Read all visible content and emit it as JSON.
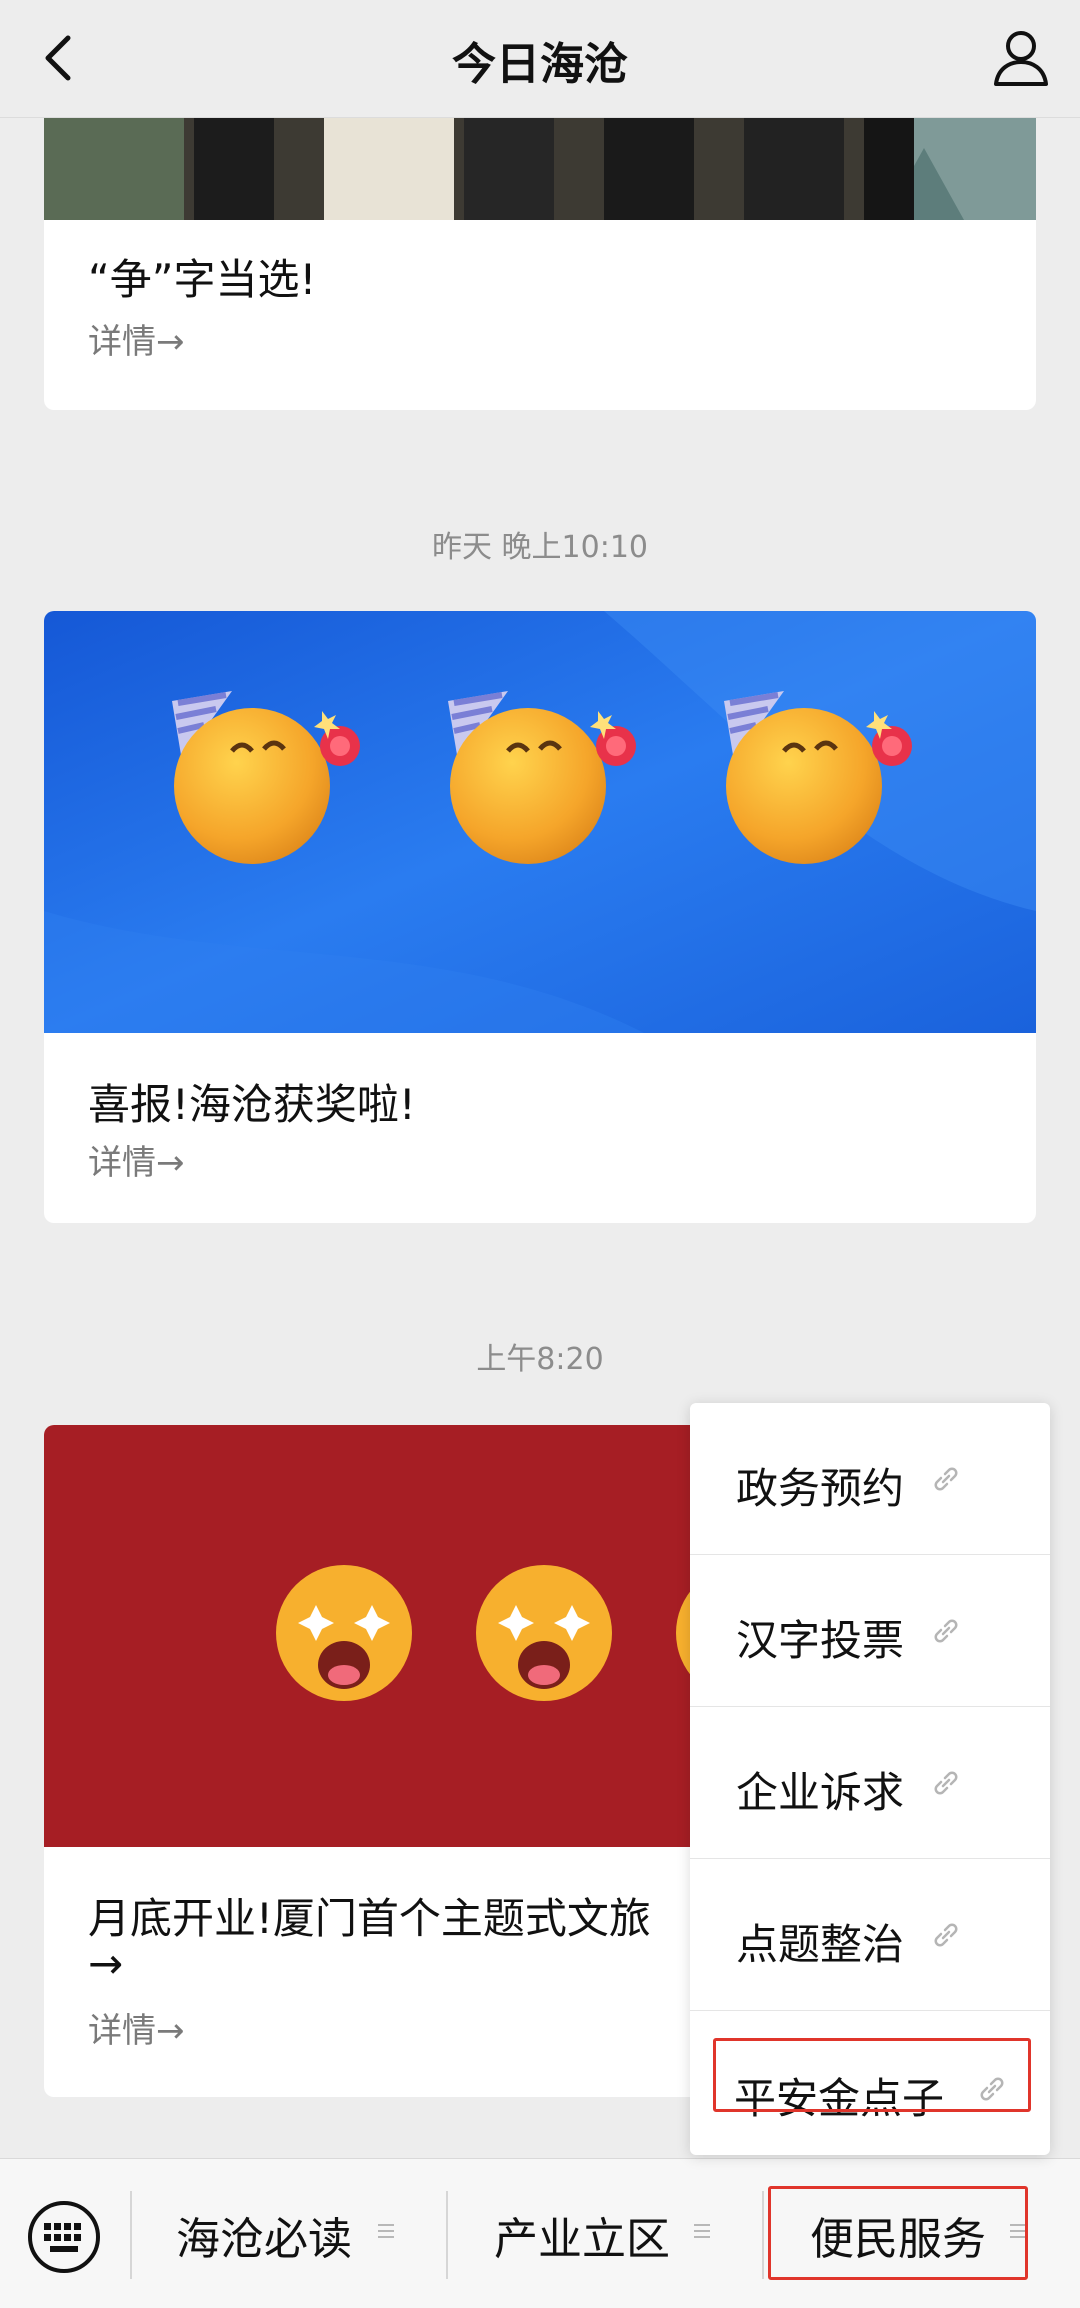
{
  "header": {
    "title": "今日海沧"
  },
  "feed": {
    "cards": [
      {
        "title": "“争”字当选!",
        "more": "详情→"
      },
      {
        "title": "喜报!海沧获奖啦!",
        "more": "详情→"
      },
      {
        "title": "月底开业!厦门首个主题式文旅",
        "title_line2": "→",
        "more": "详情→"
      }
    ],
    "timestamps": [
      "昨天 晚上10:10",
      "上午8:20"
    ]
  },
  "popup_menu": {
    "items": [
      {
        "label": "政务预约"
      },
      {
        "label": "汉字投票"
      },
      {
        "label": "企业诉求"
      },
      {
        "label": "点题整治"
      },
      {
        "label": "平安金点子"
      }
    ]
  },
  "bottom_menu": {
    "tabs": [
      {
        "label": "海沧必读"
      },
      {
        "label": "产业立区"
      },
      {
        "label": "便民服务"
      }
    ]
  },
  "colors": {
    "highlight": "#e0352b",
    "banner_blue": "#1f6fe0",
    "banner_red": "#a61e24",
    "emoji_yellow": "#f7a928"
  }
}
